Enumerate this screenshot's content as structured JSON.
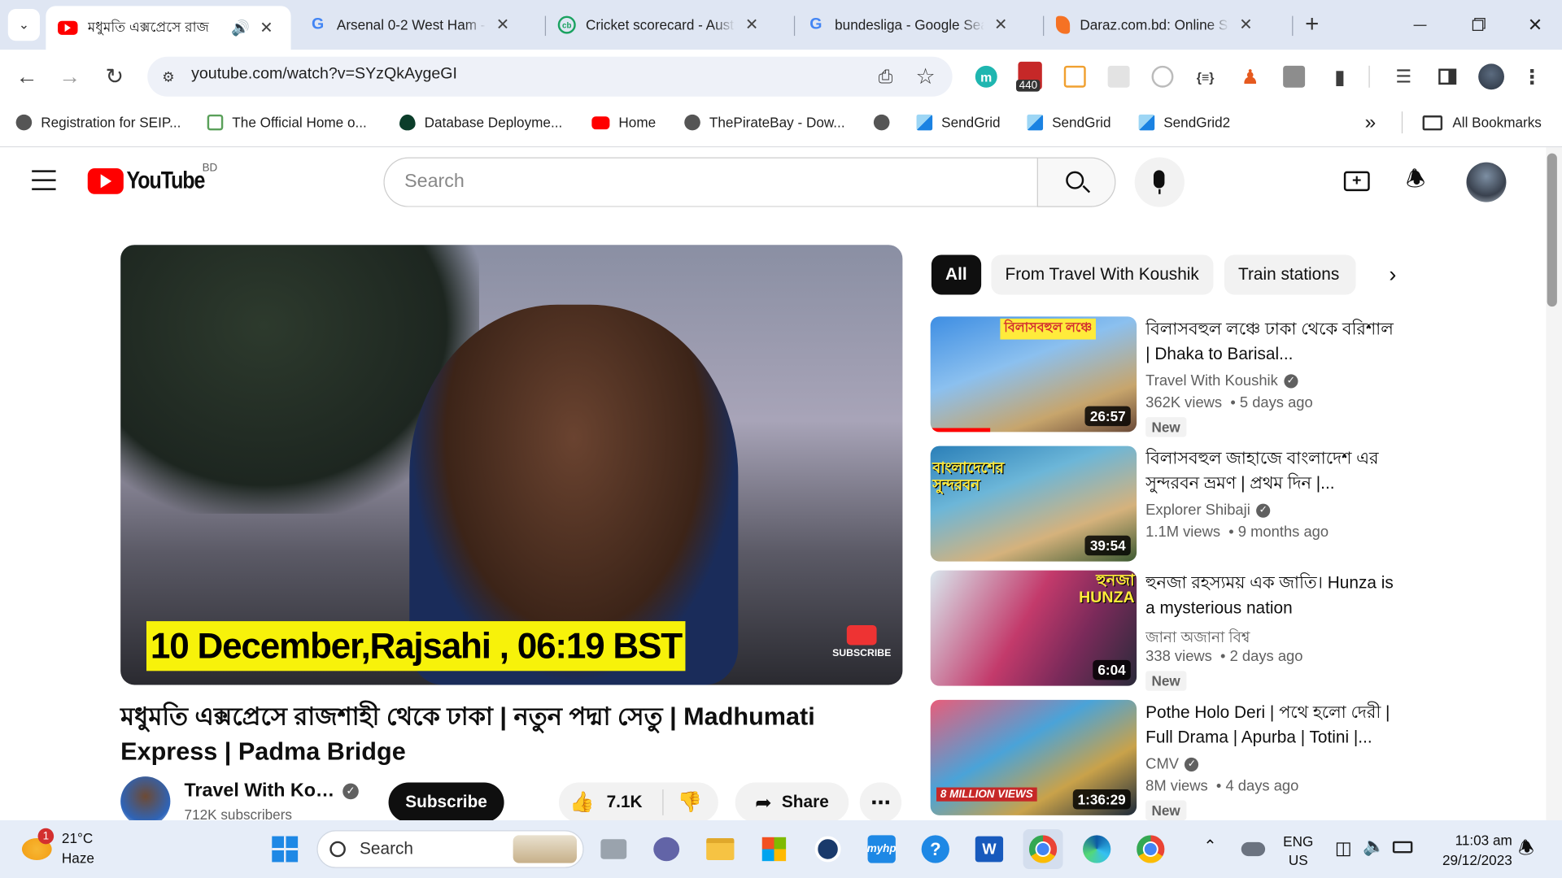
{
  "browser": {
    "tabs": [
      {
        "title": "মধুমতি এক্সপ্রেসে রাজ",
        "active": true,
        "icon": "youtube-icon"
      },
      {
        "title": "Arsenal 0-2 West Ham - G",
        "icon": "google-icon"
      },
      {
        "title": "Cricket scorecard - Austra",
        "icon": "cricbuzz-icon"
      },
      {
        "title": "bundesliga - Google Sear",
        "icon": "google-icon"
      },
      {
        "title": "Daraz.com.bd: Online Sh",
        "icon": "daraz-icon"
      }
    ],
    "url": "youtube.com/watch?v=SYzQkAygeGI",
    "extension_badge": "440",
    "bookmarks": [
      "Registration for SEIP...",
      "The Official Home o...",
      "Database Deployme...",
      "Home",
      "ThePirateBay - Dow...",
      "",
      "SendGrid",
      "SendGrid",
      "SendGrid2"
    ],
    "all_bookmarks": "All Bookmarks",
    "more_bookmarks": "»"
  },
  "youtube": {
    "logo_text": "YouTube",
    "country": "BD",
    "search_placeholder": "Search",
    "video": {
      "overlay_caption": "10 December,Rajsahi , 06:19 BST",
      "overlay_subscribe": "SUBSCRIBE",
      "title": "মধুমতি এক্সপ্রেসে রাজশাহী থেকে ঢাকা | নতুন পদ্মা সেতু | Madhumati Express | Padma Bridge",
      "channel": "Travel With Kou...",
      "subscribers": "712K subscribers",
      "subscribe_label": "Subscribe",
      "likes": "7.1K",
      "share_label": "Share",
      "more_label": "⋯"
    },
    "chips": [
      "All",
      "From Travel With Koushik",
      "Train stations"
    ],
    "recommendations": [
      {
        "title": "বিলাসবহুল লঞ্চে ঢাকা থেকে বরিশাল | Dhaka to Barisal...",
        "channel": "Travel With Koushik",
        "verified": true,
        "views": "362K views",
        "age": "5 days ago",
        "badge": "New",
        "duration": "26:57",
        "thumb_caption": "বিলাসবহুল লঞ্চে"
      },
      {
        "title": "বিলাসবহুল জাহাজে বাংলাদেশ এর সুন্দরবন ভ্রমণ | প্রথম দিন |...",
        "channel": "Explorer Shibaji",
        "verified": true,
        "views": "1.1M views",
        "age": "9 months ago",
        "badge": "",
        "duration": "39:54",
        "thumb_caption": "বাংলাদেশের সুন্দরবন"
      },
      {
        "title": "হুনজা রহস্যময় এক জাতি। Hunza is a mysterious nation",
        "channel": "জানা অজানা বিশ্ব",
        "verified": false,
        "views": "338 views",
        "age": "2 days ago",
        "badge": "New",
        "duration": "6:04",
        "thumb_caption": "হুনজা HUNZA"
      },
      {
        "title": "Pothe Holo Deri | পথে হলো দেরী | Full Drama | Apurba | Totini |...",
        "channel": "CMV",
        "verified": true,
        "views": "8M views",
        "age": "4 days ago",
        "badge": "New",
        "duration": "1:36:29",
        "thumb_caption": "8 MILLION VIEWS"
      }
    ]
  },
  "taskbar": {
    "weather_temp": "21°C",
    "weather_desc": "Haze",
    "weather_badge": "1",
    "search_label": "Search",
    "lang_top": "ENG",
    "lang_bottom": "US",
    "time": "11:03 am",
    "date": "29/12/2023"
  }
}
